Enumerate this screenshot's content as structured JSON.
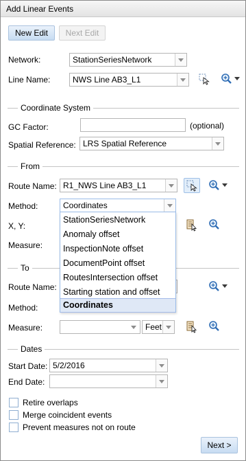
{
  "window": {
    "title": "Add Linear Events"
  },
  "toolbar": {
    "new_edit": "New Edit",
    "next_edit": "Next Edit"
  },
  "network": {
    "label": "Network:",
    "value": "StationSeriesNetwork"
  },
  "line_name": {
    "label": "Line Name:",
    "value": "NWS Line AB3_L1"
  },
  "coordinate_system": {
    "heading": "Coordinate System",
    "gc_factor_label": "GC Factor:",
    "gc_factor_value": "",
    "optional_note": "(optional)",
    "spatial_ref_label": "Spatial Reference:",
    "spatial_ref_value": "LRS Spatial Reference"
  },
  "from": {
    "heading": "From",
    "route_label": "Route Name:",
    "route_value": "R1_NWS Line AB3_L1",
    "method_label": "Method:",
    "method_value": "Coordinates",
    "xy_label": "X, Y:",
    "measure_label": "Measure:"
  },
  "method_options": [
    "StationSeriesNetwork",
    "Anomaly offset",
    "InspectionNote offset",
    "DocumentPoint offset",
    "RoutesIntersection offset",
    "Starting station and offset",
    "Coordinates"
  ],
  "to": {
    "heading": "To",
    "route_label": "Route Name:",
    "method_label": "Method:",
    "measure_label": "Measure:",
    "measure_value": "",
    "unit_value": "Feet"
  },
  "dates": {
    "heading": "Dates",
    "start_label": "Start Date:",
    "start_value": "5/2/2016",
    "end_label": "End Date:",
    "end_value": ""
  },
  "options": {
    "retire_overlaps": "Retire overlaps",
    "merge_coincident": "Merge coincident events",
    "prevent_measures": "Prevent measures not on route"
  },
  "footer": {
    "next": "Next >"
  },
  "colors": {
    "accent_blue": "#2f6db5",
    "selected_bg": "#dfe8f6",
    "border": "#b5b5b5"
  }
}
